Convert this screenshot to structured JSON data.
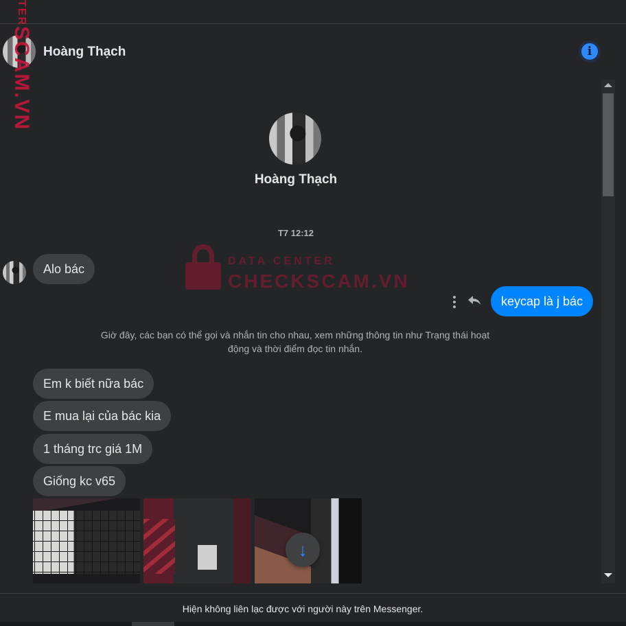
{
  "header": {
    "contact_name": "Hoàng Thạch",
    "info_icon": "info-icon"
  },
  "profile": {
    "name": "Hoàng Thạch"
  },
  "timestamp": "T7 12:12",
  "messages": {
    "incoming_first": "Alo bác",
    "outgoing": "keycap là j bác",
    "incoming": [
      "Em k biết nữa bác",
      "E mua lại của bác kia",
      "1 tháng trc giá 1M",
      "Giống kc v65"
    ]
  },
  "system_note": "Giờ đây, các bạn có thể gọi và nhắn tin cho nhau, xem những thông tin như Trạng thái hoạt động và thời điểm đọc tin nhắn.",
  "footer_note": "Hiện không liên lạc được với người này trên Messenger.",
  "watermark": {
    "side_top": "TER",
    "side_main": "SCAM.VN",
    "line1": "DATA CENTER",
    "line2": "CHECKSCAM.VN"
  },
  "colors": {
    "background": "#242526",
    "incoming_bubble": "#3e4042",
    "outgoing_bubble": "#0084ff",
    "accent": "#2e89ff",
    "watermark": "#c4173c"
  }
}
